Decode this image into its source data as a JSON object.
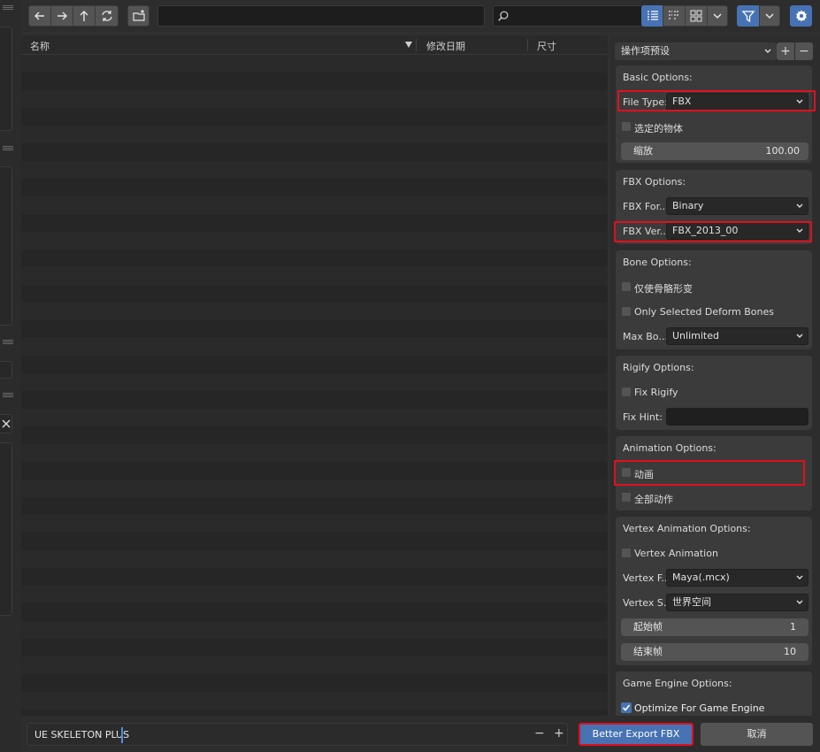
{
  "toolbar": {
    "path_value": "",
    "search_value": "",
    "icons": [
      "back-icon",
      "forward-icon",
      "parent-dir-icon",
      "refresh-icon",
      "new-folder-icon",
      "search-icon",
      "display-list-icon",
      "display-thumbs-vertical-icon",
      "display-thumbs-icon",
      "chevron-down-icon",
      "filter-icon",
      "chevron-down-icon",
      "gear-icon"
    ]
  },
  "filelist": {
    "col_name": "名称",
    "col_date": "修改日期",
    "col_size": "尺寸"
  },
  "panel": {
    "preset_label": "操作项预设",
    "basic": {
      "header": "Basic Options:",
      "file_type_label": "File Type:",
      "file_type_value": "FBX",
      "selected_label": "选定的物体",
      "scale_label": "缩放",
      "scale_value": "100.00"
    },
    "fbx": {
      "header": "FBX Options:",
      "format_label": "FBX For...",
      "format_value": "Binary",
      "version_label": "FBX Ver...",
      "version_value": "FBX_2013_00"
    },
    "bone": {
      "header": "Bone Options:",
      "deform_only_label": "仅使骨骼形变",
      "only_selected_label": "Only Selected Deform Bones",
      "max_bones_label": "Max Bo...",
      "max_bones_value": "Unlimited"
    },
    "rigify": {
      "header": "Rigify Options:",
      "fix_rigify_label": "Fix Rigify",
      "fix_hint_label": "Fix Hint:",
      "fix_hint_value": ""
    },
    "animation": {
      "header": "Animation Options:",
      "animation_label": "动画",
      "all_actions_label": "全部动作"
    },
    "vertex": {
      "header": "Vertex Animation Options:",
      "vertex_anim_label": "Vertex Animation",
      "vertex_format_label": "Vertex F...",
      "vertex_format_value": "Maya(.mcx)",
      "vertex_space_label": "Vertex S...",
      "vertex_space_value": "世界空间",
      "start_label": "起始帧",
      "start_value": "1",
      "end_label": "结束帧",
      "end_value": "10"
    },
    "engine": {
      "header": "Game Engine Options:",
      "optimize_label": "Optimize For Game Engine",
      "optimize_checked": true
    }
  },
  "bottom": {
    "filename_value": "UE SKELETON PLUS",
    "minus": "−",
    "plus": "+",
    "export_label": "Better Export FBX",
    "cancel_label": "取消"
  },
  "colors": {
    "accent": "#4772b3",
    "highlight_box": "#e0101e"
  }
}
